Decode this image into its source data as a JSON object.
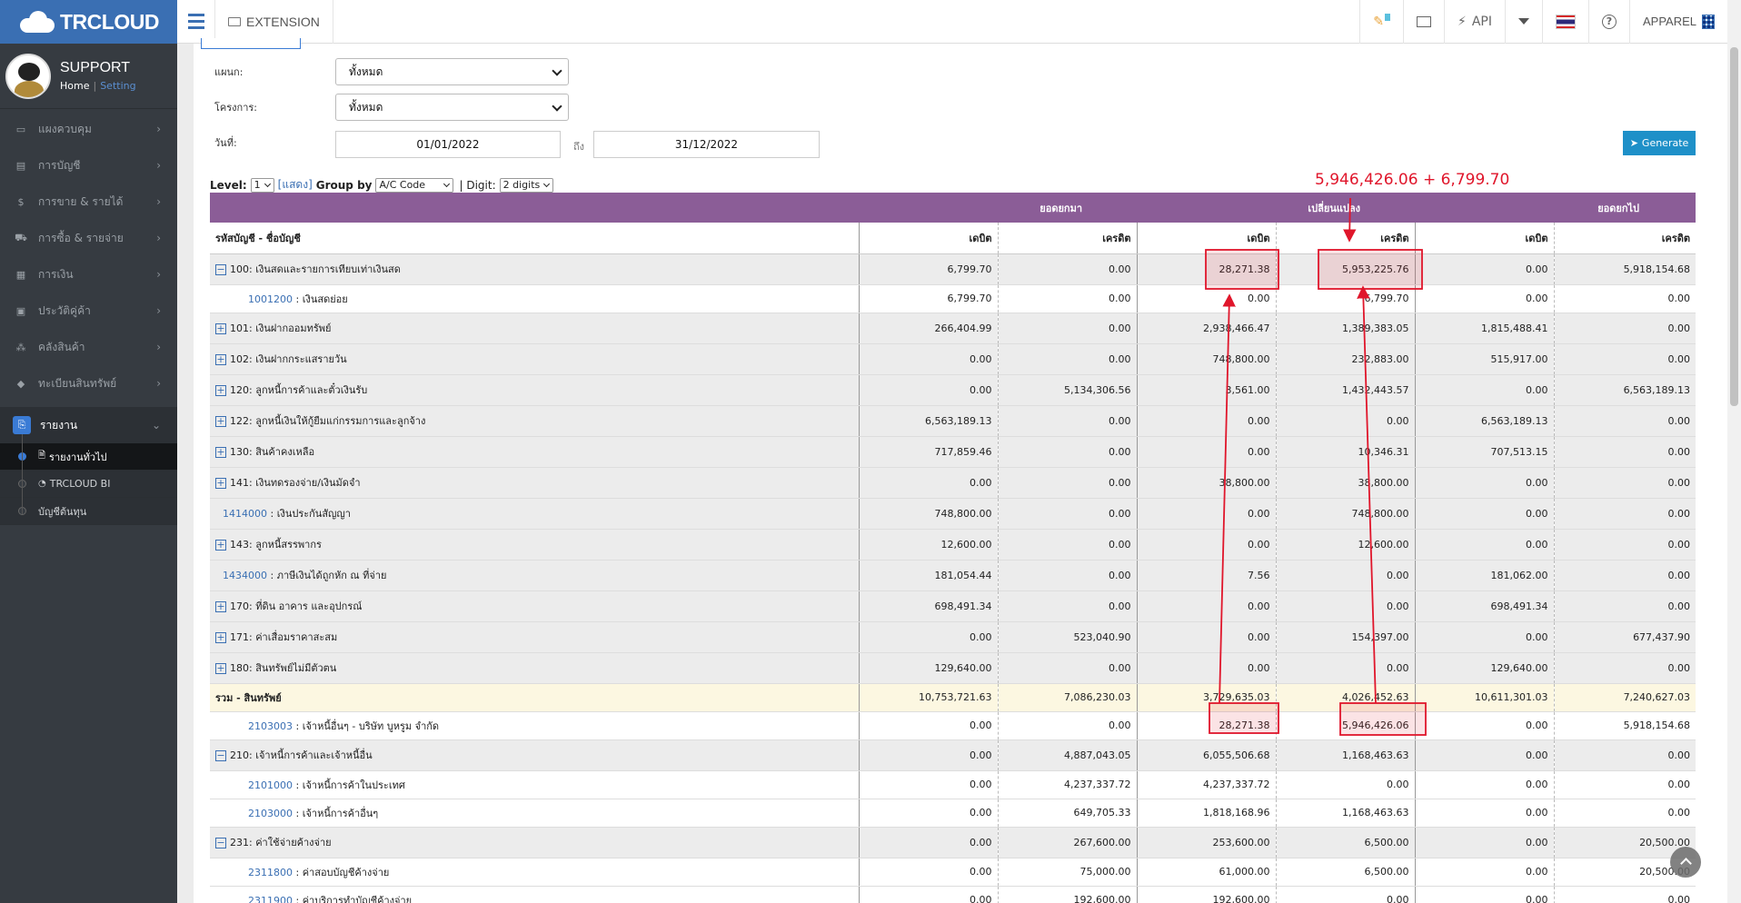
{
  "brand": "TRCLOUD",
  "profile": {
    "name": "SUPPORT",
    "home": "Home",
    "sep": "|",
    "setting": "Setting"
  },
  "nav": [
    {
      "label": "แผงควบคุม",
      "icon": "monitor-icon",
      "glyph": "▭"
    },
    {
      "label": "การบัญชี",
      "icon": "book-icon",
      "glyph": "▤"
    },
    {
      "label": "การขาย & รายได้",
      "icon": "dollar-icon",
      "glyph": "$"
    },
    {
      "label": "การซื้อ & รายจ่าย",
      "icon": "cart-icon",
      "glyph": "⛟"
    },
    {
      "label": "การเงิน",
      "icon": "calendar-icon",
      "glyph": "▦"
    },
    {
      "label": "ประวัติคู่ค้า",
      "icon": "contact-icon",
      "glyph": "▣"
    },
    {
      "label": "คลังสินค้า",
      "icon": "cubes-icon",
      "glyph": "⁂"
    },
    {
      "label": "ทะเบียนสินทรัพย์",
      "icon": "diamond-icon",
      "glyph": "◆"
    },
    {
      "label": "รายงาน",
      "icon": "report-icon",
      "glyph": "⎘"
    }
  ],
  "subnav": [
    {
      "label": "รายงานทั่วไป",
      "icon": "file-icon",
      "glyph": "🗎"
    },
    {
      "label": "TRCLOUD BI",
      "icon": "pie-chart-icon",
      "glyph": "◔"
    },
    {
      "label": "บัญชีต้นทุน",
      "icon": "",
      "glyph": ""
    }
  ],
  "topbar": {
    "extension": "EXTENSION",
    "api": "API",
    "apparel": "APPAREL"
  },
  "form": {
    "dept_label": "แผนก:",
    "dept_value": "ทั้งหมด",
    "project_label": "โครงการ:",
    "project_value": "ทั้งหมด",
    "date_label": "วันที่:",
    "date_from": "01/01/2022",
    "date_to_label": "ถึง",
    "date_to": "31/12/2022",
    "generate": "Generate"
  },
  "levelbar": {
    "level_label": "Level:",
    "level_value": "1",
    "show_link": "[แสดง]",
    "groupby_label": "Group by",
    "groupby_value": "A/C Code",
    "digit_label": "| Digit:",
    "digit_value": "2 digits"
  },
  "table": {
    "groups": [
      "ยอดยกมา",
      "เปลี่ยนแปลง",
      "ยอดยกไป"
    ],
    "name_header": "รหัสบัญชี - ชื่อบัญชี",
    "debit": "เดบิต",
    "credit": "เครดิต",
    "rows": [
      {
        "type": "gray",
        "sign": "−",
        "code": "",
        "name": "100: เงินสดและรายการเทียบเท่าเงินสด",
        "v": [
          "6,799.70",
          "0.00",
          "28,271.38",
          "5,953,225.76",
          "0.00",
          "5,918,154.68"
        ]
      },
      {
        "type": "white",
        "sign": "",
        "code": "1001200",
        "name": " : เงินสดย่อย",
        "v": [
          "6,799.70",
          "0.00",
          "0.00",
          "6,799.70",
          "0.00",
          "0.00"
        ]
      },
      {
        "type": "gray",
        "sign": "+",
        "code": "",
        "name": "101: เงินฝากออมทรัพย์",
        "v": [
          "266,404.99",
          "0.00",
          "2,938,466.47",
          "1,389,383.05",
          "1,815,488.41",
          "0.00"
        ]
      },
      {
        "type": "gray",
        "sign": "+",
        "code": "",
        "name": "102: เงินฝากกระแสรายวัน",
        "v": [
          "0.00",
          "0.00",
          "748,800.00",
          "232,883.00",
          "515,917.00",
          "0.00"
        ]
      },
      {
        "type": "gray",
        "sign": "+",
        "code": "",
        "name": "120: ลูกหนี้การค้าและตั๋วเงินรับ",
        "v": [
          "0.00",
          "5,134,306.56",
          "3,561.00",
          "1,432,443.57",
          "0.00",
          "6,563,189.13"
        ]
      },
      {
        "type": "gray",
        "sign": "+",
        "code": "",
        "name": "122: ลูกหนี้เงินให้กู้ยืมแก่กรรมการและลูกจ้าง",
        "v": [
          "6,563,189.13",
          "0.00",
          "0.00",
          "0.00",
          "6,563,189.13",
          "0.00"
        ]
      },
      {
        "type": "gray",
        "sign": "+",
        "code": "",
        "name": "130: สินค้าคงเหลือ",
        "v": [
          "717,859.46",
          "0.00",
          "0.00",
          "10,346.31",
          "707,513.15",
          "0.00"
        ]
      },
      {
        "type": "gray",
        "sign": "+",
        "code": "",
        "name": "141: เงินทดรองจ่าย/เงินมัดจำ",
        "v": [
          "0.00",
          "0.00",
          "38,800.00",
          "38,800.00",
          "0.00",
          "0.00"
        ]
      },
      {
        "type": "gray",
        "sign": "",
        "code": "1414000",
        "name": " : เงินประกันสัญญา",
        "v": [
          "748,800.00",
          "0.00",
          "0.00",
          "748,800.00",
          "0.00",
          "0.00"
        ]
      },
      {
        "type": "gray",
        "sign": "+",
        "code": "",
        "name": "143: ลูกหนี้สรรพากร",
        "v": [
          "12,600.00",
          "0.00",
          "0.00",
          "12,600.00",
          "0.00",
          "0.00"
        ]
      },
      {
        "type": "gray",
        "sign": "",
        "code": "1434000",
        "name": " : ภาษีเงินได้ถูกหัก ณ ที่จ่าย",
        "v": [
          "181,054.44",
          "0.00",
          "7.56",
          "0.00",
          "181,062.00",
          "0.00"
        ]
      },
      {
        "type": "gray",
        "sign": "+",
        "code": "",
        "name": "170: ที่ดิน อาคาร และอุปกรณ์",
        "v": [
          "698,491.34",
          "0.00",
          "0.00",
          "0.00",
          "698,491.34",
          "0.00"
        ]
      },
      {
        "type": "gray",
        "sign": "+",
        "code": "",
        "name": "171: ค่าเสื่อมราคาสะสม",
        "v": [
          "0.00",
          "523,040.90",
          "0.00",
          "154,397.00",
          "0.00",
          "677,437.90"
        ]
      },
      {
        "type": "gray",
        "sign": "+",
        "code": "",
        "name": "180: สินทรัพย์ไม่มีตัวตน",
        "v": [
          "129,640.00",
          "0.00",
          "0.00",
          "0.00",
          "129,640.00",
          "0.00"
        ]
      },
      {
        "type": "total",
        "sign": "",
        "code": "",
        "name": "รวม - สินทรัพย์",
        "v": [
          "10,753,721.63",
          "7,086,230.03",
          "3,729,635.03",
          "4,026,452.63",
          "10,611,301.03",
          "7,240,627.03"
        ]
      },
      {
        "type": "white",
        "sign": "",
        "code": "2103003",
        "name": " : เจ้าหนี้อื่นๆ - บริษัท บูหรูม จำกัด",
        "v": [
          "0.00",
          "0.00",
          "28,271.38",
          "5,946,426.06",
          "0.00",
          "5,918,154.68"
        ]
      },
      {
        "type": "gray",
        "sign": "−",
        "code": "",
        "name": "210: เจ้าหนี้การค้าและเจ้าหนี้อื่น",
        "v": [
          "0.00",
          "4,887,043.05",
          "6,055,506.68",
          "1,168,463.63",
          "0.00",
          "0.00"
        ]
      },
      {
        "type": "white",
        "sign": "",
        "code": "2101000",
        "name": " : เจ้าหนี้การค้าในประเทศ",
        "v": [
          "0.00",
          "4,237,337.72",
          "4,237,337.72",
          "0.00",
          "0.00",
          "0.00"
        ]
      },
      {
        "type": "white",
        "sign": "",
        "code": "2103000",
        "name": " : เจ้าหนี้การค้าอื่นๆ",
        "v": [
          "0.00",
          "649,705.33",
          "1,818,168.96",
          "1,168,463.63",
          "0.00",
          "0.00"
        ]
      },
      {
        "type": "gray",
        "sign": "−",
        "code": "",
        "name": "231: ค่าใช้จ่ายค้างจ่าย",
        "v": [
          "0.00",
          "267,600.00",
          "253,600.00",
          "6,500.00",
          "0.00",
          "20,500.00"
        ]
      },
      {
        "type": "white",
        "sign": "",
        "code": "2311800",
        "name": " : ค่าสอบบัญชีค้างจ่าย",
        "v": [
          "0.00",
          "75,000.00",
          "61,000.00",
          "6,500.00",
          "0.00",
          "20,500.00"
        ]
      },
      {
        "type": "white",
        "sign": "",
        "code": "2311900",
        "name": " : ค่าบริการทำบัญชีค้างจ่าย",
        "v": [
          "0.00",
          "192,600.00",
          "192,600.00",
          "0.00",
          "0.00",
          "0.00"
        ]
      }
    ]
  },
  "annotation": {
    "text": "5,946,426.06 + 6,799.70",
    "color": "#e0162b"
  },
  "colors": {
    "brand": "#3a6fb3",
    "header": "#8b5d97",
    "sidebar": "#363b41",
    "total_row": "#fcf7e1",
    "generate": "#1e90c8"
  }
}
